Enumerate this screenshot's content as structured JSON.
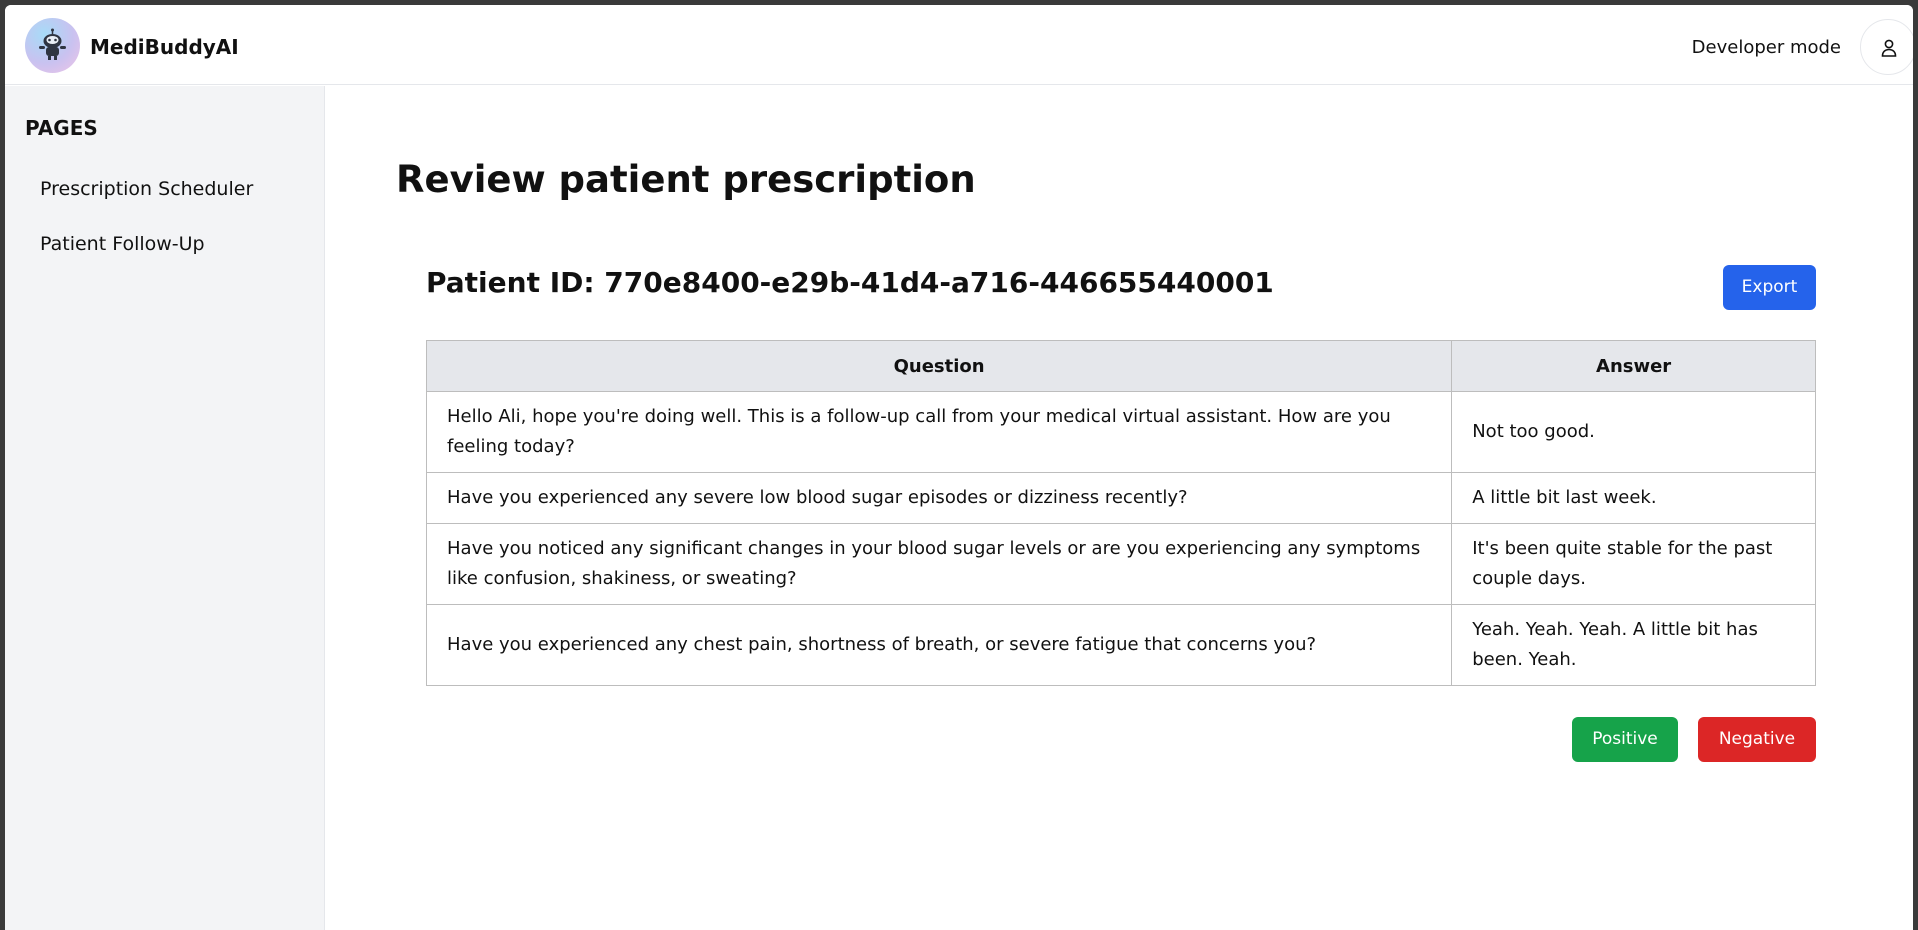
{
  "header": {
    "brand": "MediBuddyAI",
    "logo_icon": "robot-icon",
    "developer_mode_label": "Developer mode",
    "user_icon": "user-icon"
  },
  "sidebar": {
    "title": "PAGES",
    "items": [
      {
        "label": "Prescription Scheduler"
      },
      {
        "label": "Patient Follow-Up"
      }
    ]
  },
  "main": {
    "page_title": "Review patient prescription",
    "patient_id": "Patient ID: 770e8400-e29b-41d4-a716-446655440001",
    "export_label": "Export",
    "table": {
      "headers": [
        "Question",
        "Answer"
      ],
      "rows": [
        {
          "question": "Hello Ali, hope you're doing well. This is a follow-up call from your medical virtual assistant. How are you feeling today?",
          "answer": "Not too good."
        },
        {
          "question": "Have you experienced any severe low blood sugar episodes or dizziness recently?",
          "answer": "A little bit last week."
        },
        {
          "question": "Have you noticed any significant changes in your blood sugar levels or are you experiencing any symptoms like confusion, shakiness, or sweating?",
          "answer": "It's been quite stable for the past couple days."
        },
        {
          "question": "Have you experienced any chest pain, shortness of breath, or severe fatigue that concerns you?",
          "answer": "Yeah. Yeah. Yeah. A little bit has been. Yeah."
        }
      ]
    },
    "positive_label": "Positive",
    "negative_label": "Negative"
  },
  "colors": {
    "export": "#2563eb",
    "positive": "#16a34a",
    "negative": "#dc2626",
    "sidebar_bg": "#f3f4f6",
    "table_header_bg": "#e5e7eb"
  }
}
